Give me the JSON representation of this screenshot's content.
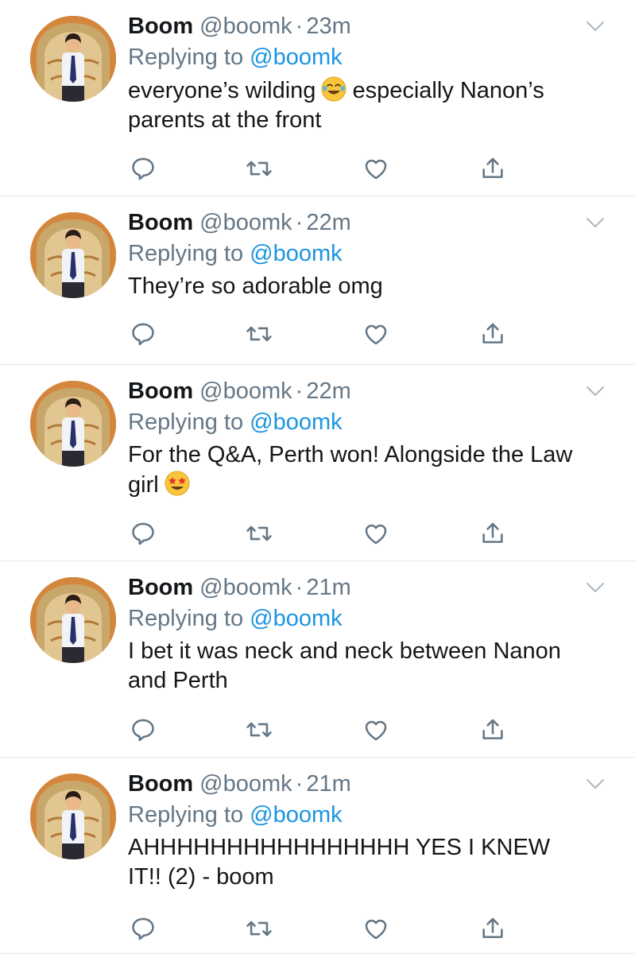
{
  "colors": {
    "text": "#14171a",
    "secondary": "#657786",
    "link": "#1b95e0",
    "divider": "#e1e8ed",
    "icon": "#657786"
  },
  "icons": {
    "reply": "speech-bubble-icon",
    "retweet": "retweet-icon",
    "like": "heart-icon",
    "share": "share-icon",
    "menu": "chevron-down-icon"
  },
  "tweets": [
    {
      "name": "Boom",
      "handle": "@boomk",
      "dot": "·",
      "time": "23m",
      "replying_prefix": "Replying to ",
      "replying_handle": "@boomk",
      "text_before": "everyone’s wilding",
      "emoji": "face-with-tears-of-joy",
      "text_after": "especially Nanon’s parents at the front"
    },
    {
      "name": "Boom",
      "handle": "@boomk",
      "dot": "·",
      "time": "22m",
      "replying_prefix": "Replying to ",
      "replying_handle": "@boomk",
      "text": "They’re so adorable omg"
    },
    {
      "name": "Boom",
      "handle": "@boomk",
      "dot": "·",
      "time": "22m",
      "replying_prefix": "Replying to ",
      "replying_handle": "@boomk",
      "text_before": "For the Q&A, Perth won! Alongside the Law girl",
      "emoji": "star-struck"
    },
    {
      "name": "Boom",
      "handle": "@boomk",
      "dot": "·",
      "time": "21m",
      "replying_prefix": "Replying to ",
      "replying_handle": "@boomk",
      "text": "I bet it was neck and neck between Nanon and Perth"
    },
    {
      "name": "Boom",
      "handle": "@boomk",
      "dot": "·",
      "time": "21m",
      "replying_prefix": "Replying to ",
      "replying_handle": "@boomk",
      "text": "AHHHHHHHHHHHHHHHH YES I KNEW IT!! (2) - boom"
    }
  ]
}
